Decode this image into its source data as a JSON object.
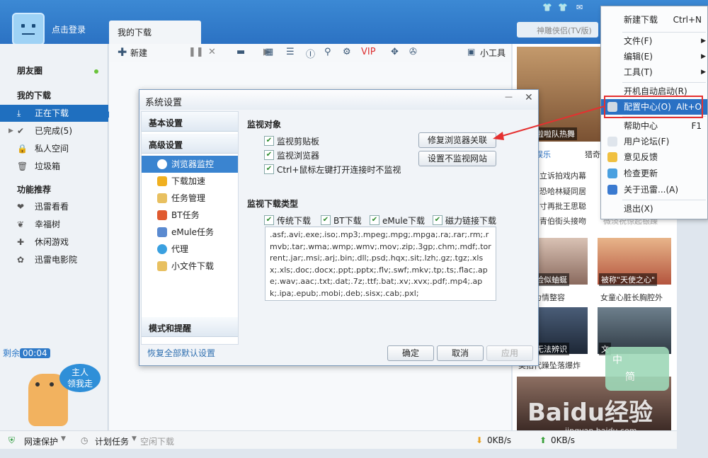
{
  "app": {
    "login_text": "点击登录",
    "tab_title": "我的下载",
    "tv_text": "神雕侠侣(TV版)"
  },
  "toolbar": {
    "new_label": "新建",
    "toolbox_label": "小工具"
  },
  "sidebar": {
    "friends": "朋友圈",
    "my_downloads": "我的下载",
    "items": [
      {
        "label": "正在下载",
        "active": true
      },
      {
        "label": "已完成(5)"
      },
      {
        "label": "私人空间"
      },
      {
        "label": "垃圾箱"
      }
    ],
    "features_head": "功能推荐",
    "features": [
      {
        "label": "迅雷看看"
      },
      {
        "label": "幸福树"
      },
      {
        "label": "休闲游戏"
      },
      {
        "label": "迅雷电影院"
      }
    ],
    "remain_label": "剩余",
    "remain_time": "00:04",
    "mascot_text": "主人\n领我走"
  },
  "statusbar": {
    "protect": "网速保护",
    "plan": "计划任务",
    "idle": "空闲下载",
    "down_speed": "0KB/s",
    "up_speed": "0KB/s"
  },
  "dialog": {
    "title": "系统设置",
    "sections": {
      "basic": "基本设置",
      "advanced": "高级设置",
      "mode": "模式和提醒"
    },
    "nav": [
      {
        "label": "浏览器监控",
        "active": true
      },
      {
        "label": "下载加速"
      },
      {
        "label": "任务管理"
      },
      {
        "label": "BT任务"
      },
      {
        "label": "eMule任务"
      },
      {
        "label": "代理"
      },
      {
        "label": "小文件下载"
      }
    ],
    "monitor_head": "监视对象",
    "monitor_opts": [
      "监视剪贴板",
      "监视浏览器",
      "Ctrl+鼠标左键打开连接时不监视"
    ],
    "repair_btn": "修复浏览器关联",
    "nomonitor_btn": "设置不监视网站",
    "types_head": "监视下载类型",
    "types": [
      "传统下载",
      "BT下载",
      "eMule下载",
      "磁力链接下载"
    ],
    "extensions": ".asf;.avi;.exe;.iso;.mp3;.mpeg;.mpg;.mpga;.ra;.rar;.rm;.rmvb;.tar;.wma;.wmp;.wmv;.mov;.zip;.3gp;.chm;.mdf;.torrent;.jar;.msi;.arj;.bin;.dll;.psd;.hqx;.sit;.lzh;.gz;.tgz;.xlsx;.xls;.doc;.docx;.ppt;.pptx;.flv;.swf;.mkv;.tp;.ts;.flac;.ape;.wav;.aac;.txt;.dat;.7z;.ttf;.bat;.xv;.xvx;.pdf;.mp4;.apk;.ipa;.epub;.mobi;.deb;.sisx;.cab;.pxl;",
    "restore": "恢复全部默认设置",
    "ok": "确定",
    "cancel": "取消",
    "apply": "应用"
  },
  "menu": {
    "items": [
      {
        "label": "新建下载",
        "shortcut": "Ctrl+N"
      },
      {
        "label": "文件(F)",
        "arrow": "▶"
      },
      {
        "label": "编辑(E)",
        "arrow": "▶"
      },
      {
        "label": "工具(T)",
        "arrow": "▶"
      },
      {
        "label": "开机自动启动(R)"
      },
      {
        "label": "配置中心(O)",
        "shortcut": "Alt+O",
        "highlight": true
      },
      {
        "label": "帮助中心",
        "shortcut": "F1"
      },
      {
        "label": "用户论坛(F)"
      },
      {
        "label": "意见反馈"
      },
      {
        "label": "检查更新"
      },
      {
        "label": "关于迅雷...(A)"
      },
      {
        "label": "退出(X)"
      }
    ]
  },
  "ads": {
    "top_caption": "妥身啦啦队热舞",
    "tabs": [
      "娱乐",
      "猎奇"
    ],
    "lines": [
      "立诉拍戏内幕",
      "恐哈林疑同居",
      "寸再批王思聪",
      "青伯街头接吻",
      "微淡祝惊起银躁"
    ],
    "captions": [
      "呼吸脸似蚰蜒",
      "被称\"天使之心\"",
      "少女为情整容",
      "女童心脏长胸腔外",
      "回应无法辨识",
      "文",
      "美拍代躁坠落爆炸"
    ],
    "watermark": "Baidu经验",
    "watermark_url": "jingyan.baidu.com",
    "ime_top": "中",
    "ime_bottom": "简"
  }
}
